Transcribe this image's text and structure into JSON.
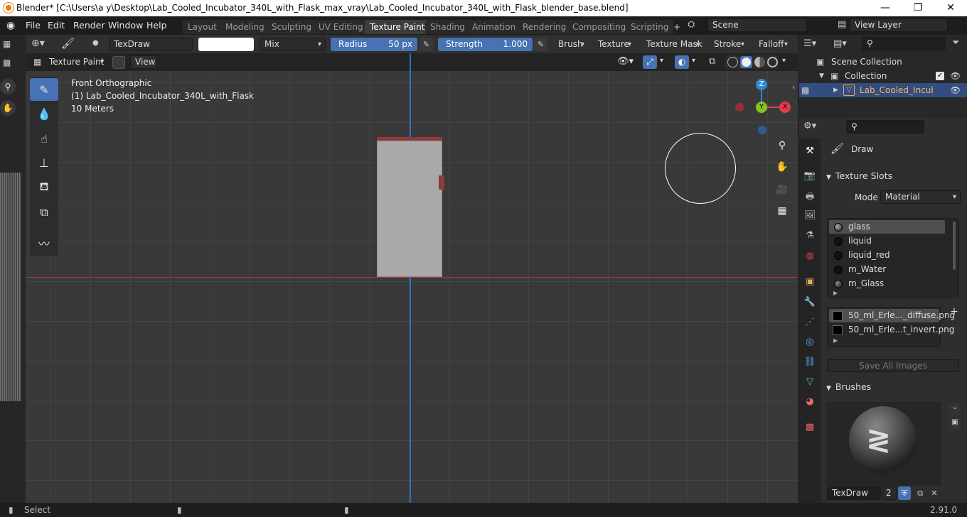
{
  "window": {
    "title": "Blender* [C:\\Users\\a y\\Desktop\\Lab_Cooled_Incubator_340L_with_Flask_max_vray\\Lab_Cooled_Incubator_340L_with_Flask_blender_base.blend]",
    "minimize": "—",
    "maximize": "❐",
    "close": "✕"
  },
  "menu": {
    "file": "File",
    "edit": "Edit",
    "render": "Render",
    "window": "Window",
    "help": "Help"
  },
  "workspaces": [
    "Layout",
    "Modeling",
    "Sculpting",
    "UV Editing",
    "Texture Paint",
    "Shading",
    "Animation",
    "Rendering",
    "Compositing",
    "Scripting"
  ],
  "workspace_active": "Texture Paint",
  "add_tab": "+",
  "scene": {
    "name": "Scene",
    "view_layer": "View Layer"
  },
  "tool_settings": {
    "brush_name": "TexDraw",
    "blend": "Mix",
    "radius_label": "Radius",
    "radius_value": "50 px",
    "strength_label": "Strength",
    "strength_value": "1.000",
    "brush_menu": "Brush",
    "texture_menu": "Texture",
    "texture_mask_menu": "Texture Mask",
    "stroke_menu": "Stroke",
    "falloff_menu": "Falloff"
  },
  "mode": {
    "label": "Texture Paint",
    "view": "View"
  },
  "viewport": {
    "view_name": "Front Orthographic",
    "object_label": "(1) Lab_Cooled_Incubator_340L_with_Flask",
    "scale": "10 Meters",
    "gizmo": {
      "z": "Z",
      "y": "Y",
      "x": "X"
    }
  },
  "outliner": {
    "scene_collection": "Scene Collection",
    "collection": "Collection",
    "object": "Lab_Cooled_Incubato"
  },
  "properties": {
    "brush_title": "Draw",
    "texture_slots_header": "Texture Slots",
    "mode_label": "Mode",
    "mode_value": "Material",
    "materials": [
      "glass",
      "liquid",
      "liquid_red",
      "m_Water",
      "m_Glass"
    ],
    "images": [
      "50_ml_Erle..._diffuse.png",
      "50_ml_Erle...t_invert.png"
    ],
    "save_all": "Save All Images",
    "brushes_header": "Brushes",
    "brush_slot_name": "TexDraw",
    "brush_users": "2"
  },
  "status": {
    "select": "Select",
    "version": "2.91.0"
  },
  "colors": {
    "accent_blue": "#4772b3",
    "x_axis": "#e63c4b",
    "y_axis": "#8bc121",
    "z_axis": "#2b8bd6"
  }
}
